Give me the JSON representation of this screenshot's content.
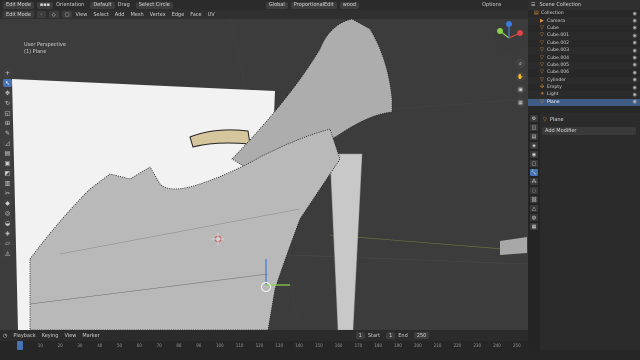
{
  "header": {
    "mode": "Edit Mode",
    "orientation": "Global",
    "orientation_label": "Orientation",
    "transform_pivot": "Default",
    "drag": "Drag",
    "select": "Select Circle",
    "menus": [
      "View",
      "Select",
      "Add",
      "Mesh",
      "Vertex",
      "Edge",
      "Face",
      "UV"
    ],
    "proportional": "ProportionalEdit",
    "snap": "wood",
    "options": "Options"
  },
  "viewport": {
    "perspective": "User Perspective",
    "object": "(1) Plane",
    "accent_color": "#4772b3",
    "mesh_color": "#b9b9b9",
    "vertex_color": "#111111"
  },
  "toolbar": {
    "tools": [
      "cursor-icon",
      "select-icon",
      "move-icon",
      "rotate-icon",
      "scale-icon",
      "transform-icon",
      "annotate-icon",
      "measure-icon",
      "extrude-icon",
      "inset-icon",
      "bevel-icon",
      "loopcut-icon",
      "knife-icon",
      "polybuild-icon",
      "spin-icon",
      "smooth-icon",
      "shrink-icon",
      "shear-icon",
      "rip-icon"
    ]
  },
  "outliner": {
    "title": "Scene Collection",
    "items": [
      {
        "label": "Collection",
        "icon": "collection-icon",
        "depth": 0
      },
      {
        "label": "Camera",
        "icon": "camera-icon",
        "depth": 1
      },
      {
        "label": "Cube",
        "icon": "mesh-icon",
        "depth": 1
      },
      {
        "label": "Cube.001",
        "icon": "mesh-icon",
        "depth": 1
      },
      {
        "label": "Cube.002",
        "icon": "mesh-icon",
        "depth": 1
      },
      {
        "label": "Cube.003",
        "icon": "mesh-icon",
        "depth": 1
      },
      {
        "label": "Cube.004",
        "icon": "mesh-icon",
        "depth": 1
      },
      {
        "label": "Cube.005",
        "icon": "mesh-icon",
        "depth": 1
      },
      {
        "label": "Cube.006",
        "icon": "mesh-icon",
        "depth": 1
      },
      {
        "label": "Cylinder",
        "icon": "mesh-icon",
        "depth": 1
      },
      {
        "label": "Empty",
        "icon": "empty-icon",
        "depth": 1
      },
      {
        "label": "Light",
        "icon": "light-icon",
        "depth": 1
      },
      {
        "label": "Plane",
        "icon": "mesh-icon",
        "depth": 1,
        "selected": true
      }
    ]
  },
  "properties": {
    "object_name": "Plane",
    "field": "Add Modifier"
  },
  "timeline": {
    "playback": "Playback",
    "keying": "Keying",
    "view": "View",
    "marker": "Marker",
    "current_frame": "1",
    "start_label": "Start",
    "start": "1",
    "end_label": "End",
    "end": "250",
    "ticks": [
      "0",
      "10",
      "20",
      "30",
      "40",
      "50",
      "60",
      "70",
      "80",
      "90",
      "100",
      "110",
      "120",
      "130",
      "140",
      "150",
      "160",
      "170",
      "180",
      "190",
      "200",
      "210",
      "220",
      "230",
      "240",
      "250"
    ]
  }
}
